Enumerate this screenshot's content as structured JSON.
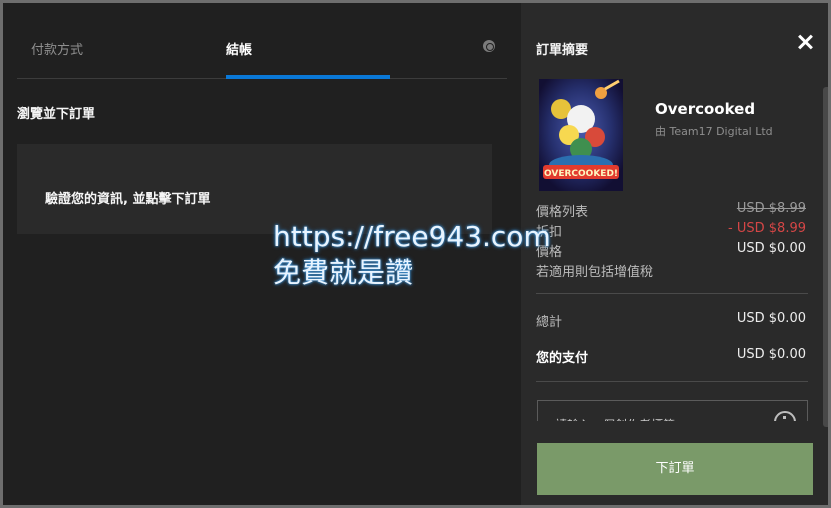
{
  "tabs": {
    "payment_label": "付款方式",
    "checkout_label": "結帳"
  },
  "left": {
    "review_title": "瀏覽並下訂單",
    "info_message": "驗證您的資訊, 並點擊下訂單"
  },
  "watermark": {
    "url": "https://free943.com",
    "slogan": "免費就是讚"
  },
  "summary": {
    "title": "訂單摘要",
    "game_title": "Overcooked",
    "publisher": "由 Team17 Digital Ltd",
    "cover_text": "OVERCOOKED!",
    "list_price_label": "價格列表",
    "list_price_value": "USD $8.99",
    "discount_label": "折扣",
    "discount_value": "- USD $8.99",
    "price_label": "價格",
    "price_value": "USD $0.00",
    "vat_note": "若適用則包括增值稅",
    "total_label": "總計",
    "total_value": "USD $0.00",
    "you_pay_label": "您的支付",
    "you_pay_value": "USD $0.00",
    "creator_placeholder": "請輸入一個創作者標籤",
    "place_order_label": "下訂單"
  },
  "colors": {
    "accent_tab": "#0a78d7",
    "place_order_bg": "#7a9a69",
    "discount_red": "#d54646"
  }
}
